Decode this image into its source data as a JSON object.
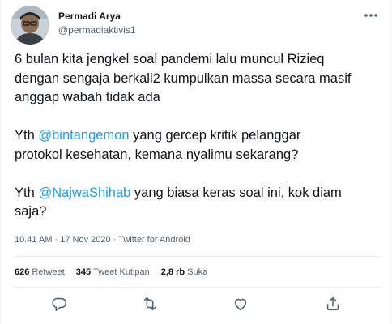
{
  "user": {
    "display_name": "Permadi Arya",
    "handle": "@permadiaktivis1"
  },
  "tweet": {
    "line1": "6 bulan kita jengkel soal pandemi lalu muncul Rizieq",
    "line2": "dengan sengaja berkali2 kumpulkan massa secara masif",
    "line3": "anggap wabah tidak ada",
    "para2_prefix": "Yth ",
    "para2_mention": "@bintangemon",
    "para2_rest": " yang gercep kritik pelanggar",
    "para2_line2": "protokol kesehatan, kemana nyalimu sekarang?",
    "para3_prefix": "Yth ",
    "para3_mention": "@NajwaShihab",
    "para3_rest": " yang biasa keras soal ini, kok diam",
    "para3_line2": "saja?"
  },
  "meta": {
    "time": "10.41 AM",
    "separator1": " · ",
    "date": "17 Nov 2020",
    "separator2": " · ",
    "source": "Twitter for Android"
  },
  "stats": {
    "retweets_count": "626",
    "retweets_label": "Retweet",
    "quotes_count": "345",
    "quotes_label": "Tweet Kutipan",
    "likes_count": "2,8 rb",
    "likes_label": "Suka"
  },
  "icons": {
    "more": "more-icon",
    "reply": "reply-icon",
    "retweet": "retweet-icon",
    "like": "heart-icon",
    "share": "share-icon"
  },
  "colors": {
    "mention": "#1d9bf0",
    "secondary_text": "#536471",
    "primary_text": "#0f1419"
  }
}
